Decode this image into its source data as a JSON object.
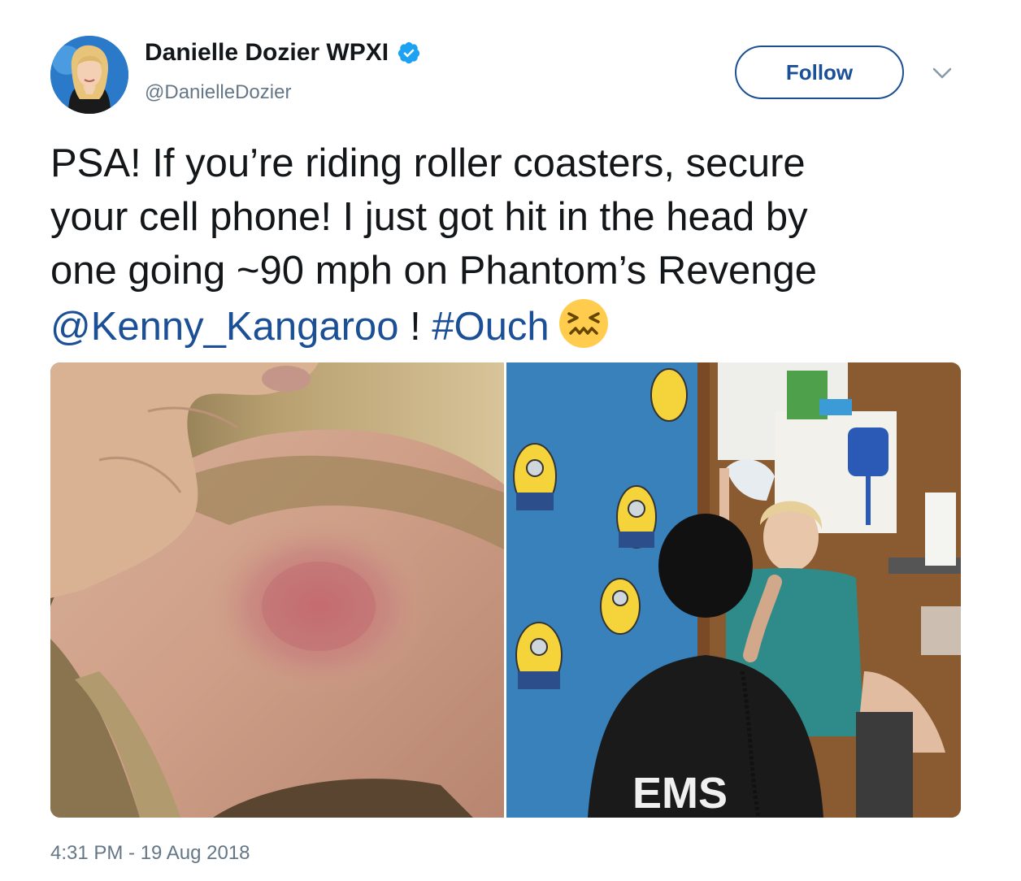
{
  "author": {
    "display_name": "Danielle Dozier WPXI",
    "handle": "@DanielleDozier",
    "verified_icon": "verified-badge-icon",
    "avatar_icon": "avatar"
  },
  "actions": {
    "follow_label": "Follow",
    "menu_icon": "chevron-down-icon"
  },
  "tweet": {
    "line1": "PSA! If you’re riding roller coasters,  secure",
    "line2": "your cell phone! I just got hit in the head by",
    "line3": "one going ~90 mph on Phantom’s Revenge",
    "mention": "@Kenny_Kangaroo",
    "separator": " ! ",
    "hashtag": "#Ouch",
    "emoji": "confounded-face-emoji"
  },
  "media": {
    "photos": [
      "bruised-forehead-photo",
      "ems-examination-photo"
    ],
    "ems_shirt_text": "EMS"
  },
  "meta": {
    "timestamp": "4:31 PM - 19 Aug 2018"
  },
  "colors": {
    "link": "#1b4f96",
    "verified": "#1da1f2",
    "muted": "#657786"
  }
}
